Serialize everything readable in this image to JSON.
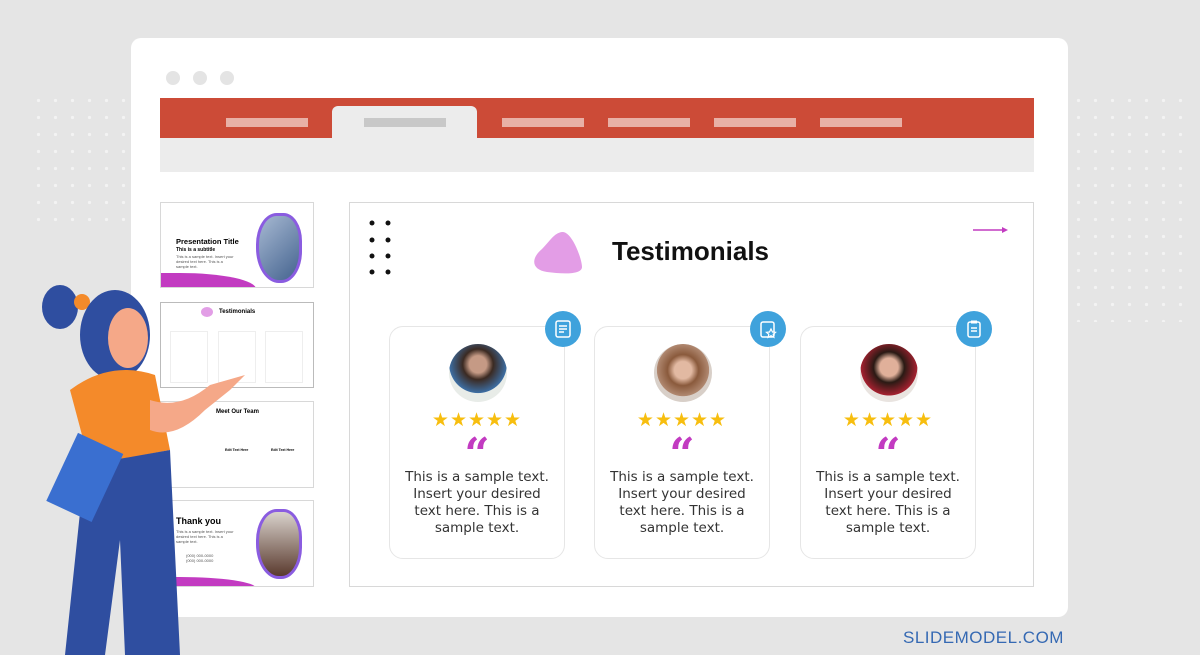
{
  "brand": "SLIDEMODEL.COM",
  "colors": {
    "ribbon": "#cc4b37",
    "accent_blue": "#3fa2dc",
    "accent_purple": "#c23bc1",
    "star": "#f7be0f"
  },
  "thumbnails": [
    {
      "title": "Presentation Title",
      "subtitle": "This is a subtitle",
      "body": "This is a sample text. Insert your desired text here. This is a sample text."
    },
    {
      "title": "Testimonials"
    },
    {
      "title": "Meet Our Team",
      "member_label": "Edit Text Here"
    },
    {
      "title": "Thank you",
      "body": "This is a sample text. Insert your desired text here. This is a sample text.",
      "phone1": "(000) 000-0000",
      "phone2": "(000) 000-0000"
    }
  ],
  "slide": {
    "title": "Testimonials",
    "cards": [
      {
        "icon": "checklist-icon",
        "stars": 5,
        "star_text": "★★★★★",
        "quote": "“",
        "text": "This is a sample text. Insert your desired text here. This is a sample text."
      },
      {
        "icon": "clipboard-star-icon",
        "stars": 5,
        "star_text": "★★★★★",
        "quote": "“",
        "text": "This is a sample text. Insert your desired text here. This is a sample text."
      },
      {
        "icon": "clipboard-icon",
        "stars": 5,
        "star_text": "★★★★★",
        "quote": "“",
        "text": "This is a sample text. Insert your desired text here. This is a sample text."
      }
    ]
  }
}
